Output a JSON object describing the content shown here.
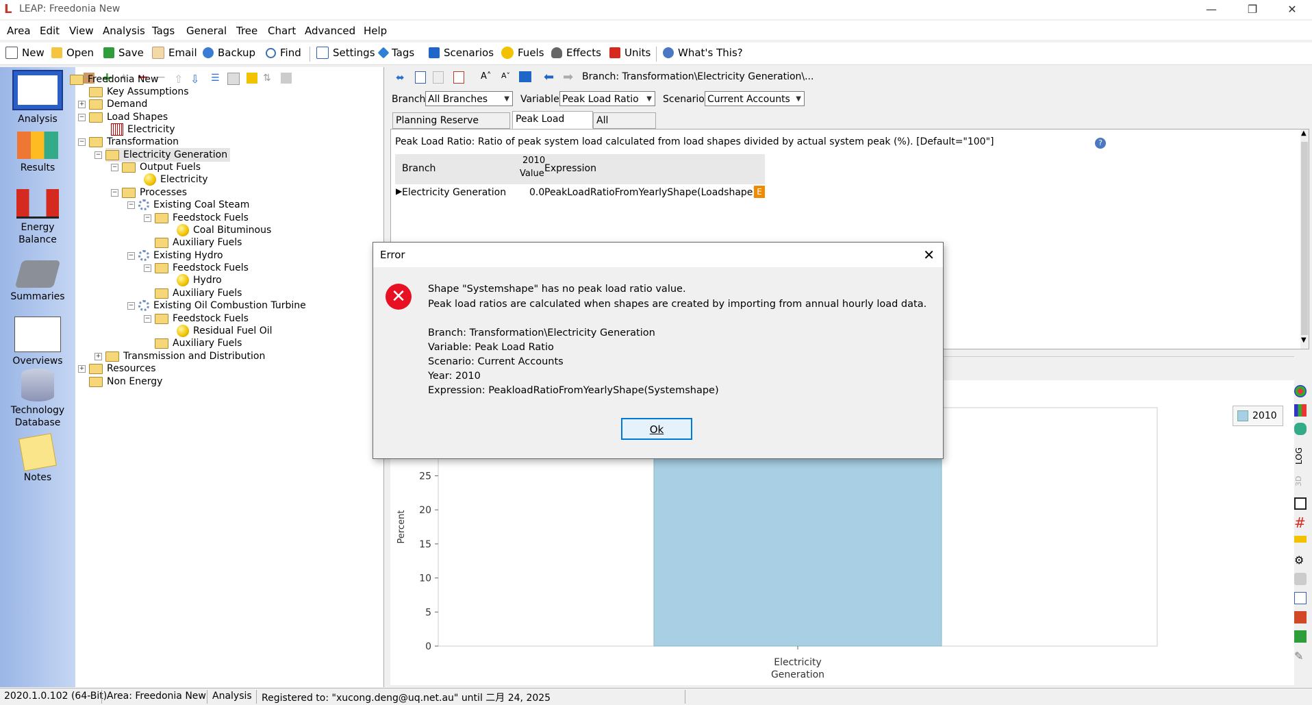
{
  "window": {
    "title": "LEAP: Freedonia New",
    "app_icon_letter": "L"
  },
  "menu": [
    "Area",
    "Edit",
    "View",
    "Analysis",
    "Tags",
    "General",
    "Tree",
    "Chart",
    "Advanced",
    "Help"
  ],
  "toolbar": {
    "new": "New",
    "open": "Open",
    "save": "Save",
    "email": "Email",
    "backup": "Backup",
    "find": "Find",
    "settings": "Settings",
    "tags": "Tags",
    "scenarios": "Scenarios",
    "fuels": "Fuels",
    "effects": "Effects",
    "units": "Units",
    "whats_this": "What's This?"
  },
  "leftnav": {
    "analysis": "Analysis",
    "results": "Results",
    "energy_balance": "Energy\nBalance",
    "summaries": "Summaries",
    "overviews": "Overviews",
    "technology_database": "Technology\nDatabase",
    "notes": "Notes"
  },
  "tree": {
    "root": "Freedonia New",
    "key_assumptions": "Key Assumptions",
    "demand": "Demand",
    "load_shapes": "Load Shapes",
    "electricity_ls": "Electricity",
    "transformation": "Transformation",
    "electricity_generation": "Electricity Generation",
    "output_fuels": "Output Fuels",
    "electricity_of": "Electricity",
    "processes": "Processes",
    "existing_coal_steam": "Existing Coal Steam",
    "feedstock_fuels_1": "Feedstock Fuels",
    "coal_bituminous": "Coal Bituminous",
    "auxiliary_fuels_1": "Auxiliary Fuels",
    "existing_hydro": "Existing Hydro",
    "feedstock_fuels_2": "Feedstock Fuels",
    "hydro": "Hydro",
    "auxiliary_fuels_2": "Auxiliary Fuels",
    "existing_oil": "Existing Oil Combustion Turbine",
    "feedstock_fuels_3": "Feedstock Fuels",
    "residual_fuel_oil": "Residual Fuel Oil",
    "auxiliary_fuels_3": "Auxiliary Fuels",
    "transmission": "Transmission and Distribution",
    "resources": "Resources",
    "non_energy": "Non Energy"
  },
  "branch_path": "Branch: Transformation\\Electricity Generation\\...",
  "filters": {
    "branch_label": "Branch:",
    "branch_value": "All Branches",
    "variable_label": "Variable:",
    "variable_value": "Peak Load Ratio",
    "scenario_label": "Scenario:",
    "scenario_value": "Current Accounts"
  },
  "tabs": [
    "Planning Reserve Margin",
    "Peak Load Ratio",
    "All Variables"
  ],
  "description": "Peak Load Ratio: Ratio of peak system load calculated from load shapes divided by actual system peak (%). [Default=\"100\"]",
  "grid": {
    "col_branch": "Branch",
    "col_value_year": "2010",
    "col_value": "Value",
    "col_expression": "Expression",
    "row": {
      "branch": "Electricity Generation",
      "value": "0.0",
      "expression": "PeakLoadRatioFromYearlyShape(Loadshape)",
      "flag": "E"
    }
  },
  "chart_data": {
    "type": "bar",
    "categories": [
      "Electricity Generation"
    ],
    "series": [
      {
        "name": "2010",
        "values": [
          35
        ]
      }
    ],
    "ylabel": "Percent",
    "yticks": [
      "0",
      "5",
      "10",
      "15",
      "20",
      "25"
    ],
    "ylim": [
      0,
      35
    ],
    "xtick_lines": [
      "Electricity",
      "Generation"
    ],
    "legend_position": "top-right",
    "bar_color": "#a8cfe3"
  },
  "right_side_labels": {
    "log": "LOG",
    "three_d": "3D"
  },
  "dialog": {
    "title": "Error",
    "line1": "Shape \"Systemshape\" has no peak load ratio value.",
    "line2": "Peak load ratios are calculated when shapes are created by importing from annual hourly load data.",
    "line3": "Branch: Transformation\\Electricity Generation",
    "line4": "Variable: Peak Load Ratio",
    "line5": "Scenario: Current Accounts",
    "line6": "Year: 2010",
    "line7": "Expression: PeakloadRatioFromYearlyShape(Systemshape)",
    "ok": "Ok"
  },
  "status": {
    "version": "2020.1.0.102 (64-Bit)",
    "area": "Area: Freedonia New",
    "mode": "Analysis",
    "registration": "Registered to: \"xucong.deng@uq.net.au\" until 二月 24, 2025"
  }
}
